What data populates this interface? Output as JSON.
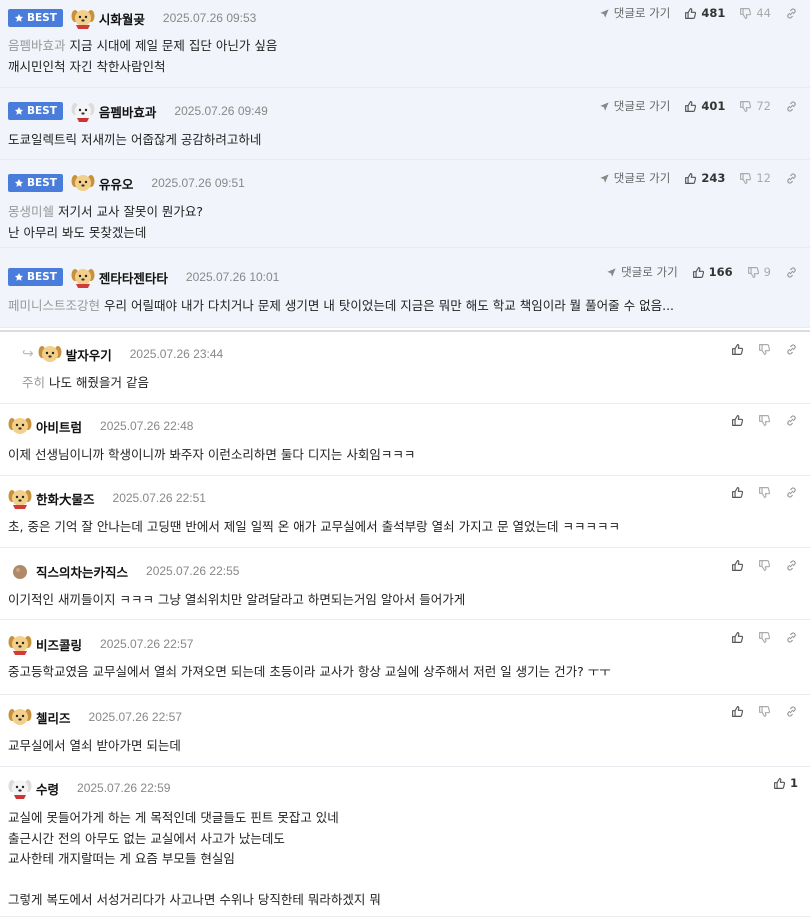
{
  "labels": {
    "best": "BEST",
    "reply": "댓글로 가기"
  },
  "comments": [
    {
      "best": true,
      "avatar": "dog-red",
      "nick": "시화월곶",
      "date": "2025.07.26 09:53",
      "up": "481",
      "down": "44",
      "mention": "음펨바효과",
      "lines": [
        "지금 시대에 제일 문제 집단 아닌가 싶음",
        "깨시민인척 자긴 착한사람인척"
      ]
    },
    {
      "best": true,
      "avatar": "dog-white",
      "nick": "음펨바효과",
      "date": "2025.07.26 09:49",
      "up": "401",
      "down": "72",
      "mention": "",
      "lines": [
        "도쿄일렉트릭 저새끼는 어줍잖게 공감하려고하네"
      ]
    },
    {
      "best": true,
      "avatar": "dog",
      "nick": "유유오",
      "date": "2025.07.26 09:51",
      "up": "243",
      "down": "12",
      "mention": "몽생미쉘",
      "lines": [
        "저기서 교사 잘못이 뭔가요?",
        "난 아무리 봐도 못찾겠는데"
      ]
    },
    {
      "best": true,
      "avatar": "dog-red",
      "nick": "젠타타젠타타",
      "date": "2025.07.26 10:01",
      "up": "166",
      "down": "9",
      "mention": "페미니스트조강현",
      "lines": [
        "우리 어릴때야 내가 다치거나 문제 생기면 내 탓이었는데 지금은 뭐만 해도 학교 책임이라 뭘 풀어줄 수 없음..."
      ]
    },
    {
      "reply": true,
      "avatar": "dog",
      "nick": "발자우기",
      "date": "2025.07.26 23:44",
      "mention": "주히",
      "lines": [
        "나도 해줬을거 같음"
      ]
    },
    {
      "avatar": "dog",
      "nick": "아비트럼",
      "date": "2025.07.26 22:48",
      "mention": "",
      "lines": [
        "이제 선생님이니까 학생이니까 봐주자 이런소리하면 둘다 디지는 사회임ㅋㅋㅋ"
      ]
    },
    {
      "avatar": "dog-red",
      "nick": "한화大물즈",
      "date": "2025.07.26 22:51",
      "mention": "",
      "lines": [
        "초, 중은 기억 잘 안나는데 고딩땐 반에서 제일 일찍 온 애가 교무실에서 출석부랑 열쇠 가지고 문 열었는데 ㅋㅋㅋㅋㅋ"
      ]
    },
    {
      "avatar": "ball",
      "nick": "직스의차는카직스",
      "date": "2025.07.26 22:55",
      "mention": "",
      "lines": [
        "이기적인 새끼들이지 ㅋㅋㅋ 그냥 열쇠위치만 알려달라고 하면되는거임 알아서 들어가게"
      ]
    },
    {
      "avatar": "dog-red",
      "nick": "비즈콜링",
      "date": "2025.07.26 22:57",
      "mention": "",
      "lines": [
        "중고등학교였음 교무실에서 열쇠 가져오면 되는데 초등이라 교사가 항상 교실에 상주해서 저런 일 생기는 건가? ㅜㅜ"
      ]
    },
    {
      "avatar": "dog",
      "nick": "첼리즈",
      "date": "2025.07.26 22:57",
      "mention": "",
      "lines": [
        "교무실에서 열쇠 받아가면 되는데"
      ]
    },
    {
      "avatar": "dog-white",
      "nick": "수령",
      "date": "2025.07.26 22:59",
      "mention": "",
      "up": "1",
      "lines": [
        "교실에 못들어가게 하는 게 목적인데 댓글들도 핀트 못잡고 있네",
        "출근시간 전의 아무도 없는 교실에서 사고가 났는데도",
        "교사한테 개지랄떠는 게 요즘 부모들 현실임",
        "",
        "그렇게 복도에서 서성거리다가 사고나면 수위나 당직한테 뭐라하겠지 뭐"
      ]
    }
  ]
}
